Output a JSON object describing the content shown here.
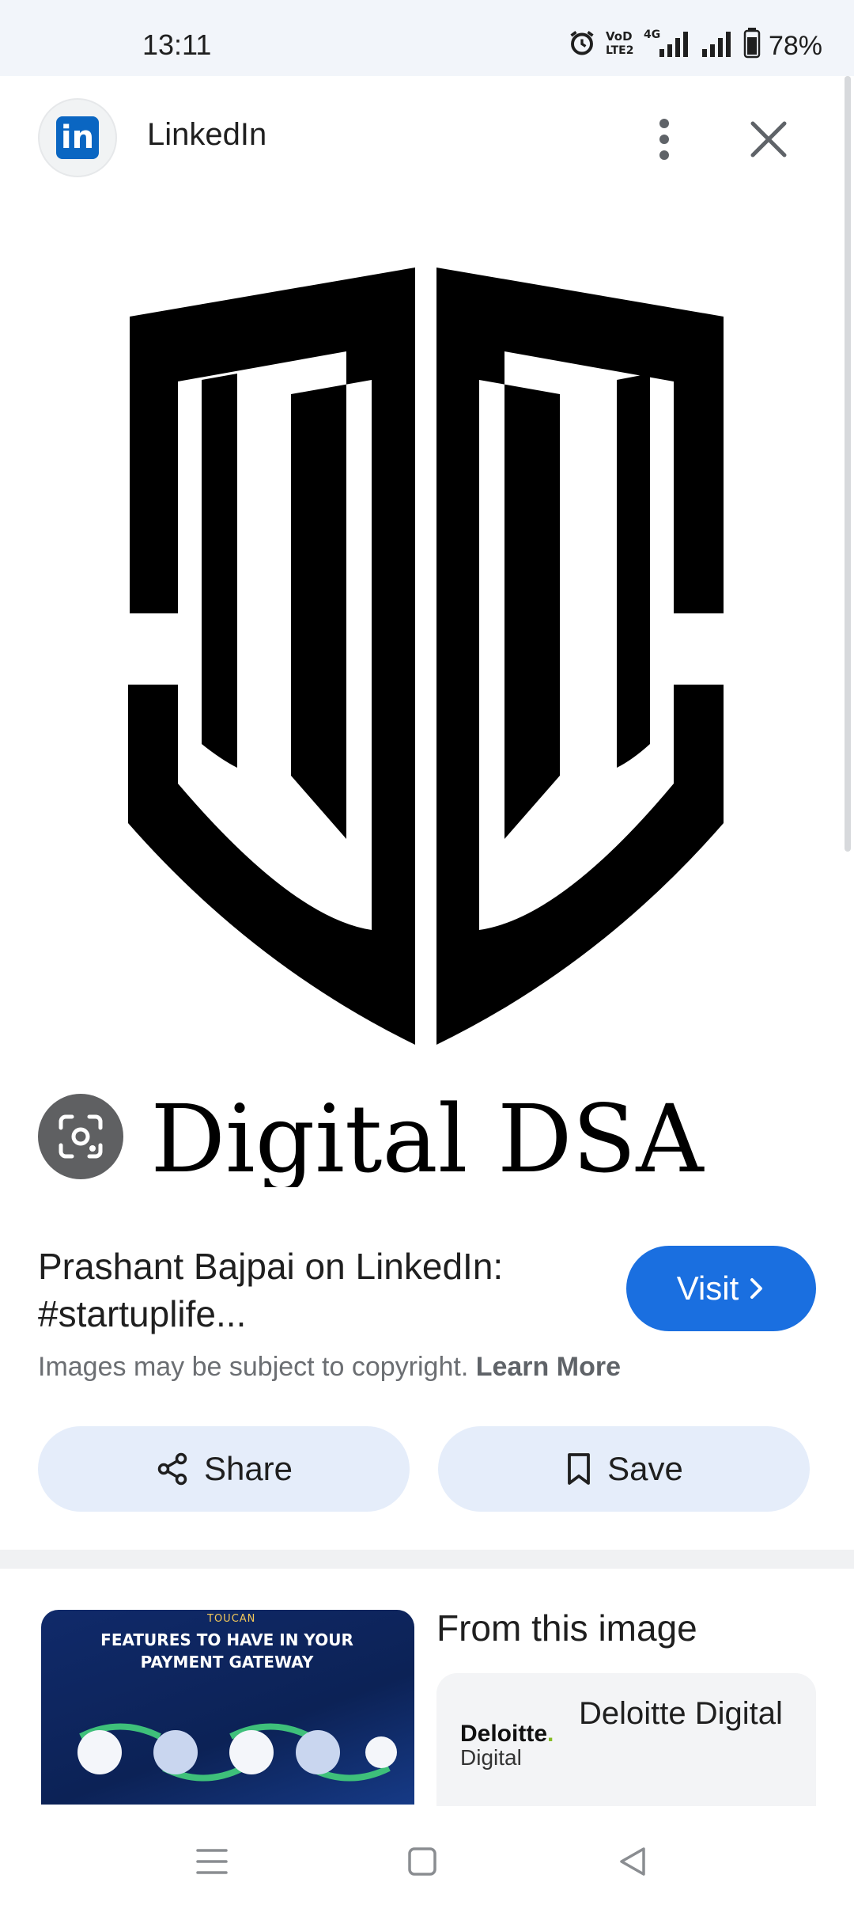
{
  "status_bar": {
    "time": "13:11",
    "network_label": "4G",
    "battery": "78%",
    "icons": [
      "alarm-icon",
      "volte-icon",
      "signal-4g-icon",
      "signal-icon",
      "battery-icon"
    ]
  },
  "header": {
    "site_name": "LinkedIn",
    "site_icon": "linkedin-icon",
    "logo_letters": "in"
  },
  "image": {
    "logo_text": "Digital DSA"
  },
  "result": {
    "title": "Prashant Bajpai on LinkedIn: #startuplife...",
    "visit_label": "Visit",
    "copyright_text": "Images may be subject to copyright.",
    "learn_more": "Learn More"
  },
  "actions": {
    "share_label": "Share",
    "save_label": "Save"
  },
  "related": {
    "thumb_brand": "TOUCAN",
    "thumb_title": "FEATURES TO HAVE IN YOUR PAYMENT GATEWAY",
    "section_title": "From this image",
    "entity_name": "Deloitte Digital",
    "entity_logo_top": "Deloitte",
    "entity_logo_bottom": "Digital"
  },
  "colors": {
    "accent": "#1a6fe0",
    "linkedin": "#0a66c2",
    "action_bg": "#e5edfa"
  }
}
